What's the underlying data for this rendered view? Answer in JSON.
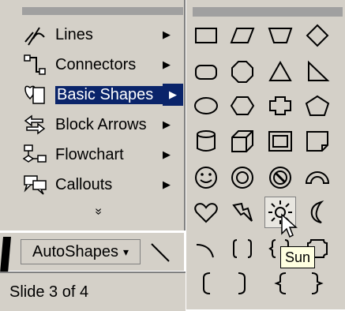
{
  "menu": {
    "items": [
      {
        "label": "Lines",
        "icon": "lines-icon",
        "has_submenu": true
      },
      {
        "label": "Connectors",
        "icon": "connectors-icon",
        "has_submenu": true
      },
      {
        "label": "Basic Shapes",
        "icon": "basic-shapes-icon",
        "has_submenu": true,
        "selected": true
      },
      {
        "label": "Block Arrows",
        "icon": "block-arrows-icon",
        "has_submenu": true
      },
      {
        "label": "Flowchart",
        "icon": "flowchart-icon",
        "has_submenu": true
      },
      {
        "label": "Callouts",
        "icon": "callouts-icon",
        "has_submenu": true
      }
    ],
    "expand_glyph": "»",
    "submenu_arrow": "▶"
  },
  "palette": {
    "shapes": [
      "rectangle",
      "parallelogram",
      "trapezoid",
      "diamond",
      "rounded-rectangle",
      "octagon",
      "isosceles-triangle",
      "right-triangle",
      "oval",
      "hexagon",
      "cross",
      "pentagon",
      "can",
      "cube",
      "bevel",
      "folded-corner",
      "smiley-face",
      "donut",
      "no-symbol",
      "block-arc",
      "heart",
      "lightning-bolt",
      "sun",
      "moon",
      "arc",
      "double-bracket",
      "double-brace",
      "plaque",
      "left-bracket",
      "right-bracket",
      "left-brace",
      "right-brace"
    ],
    "hovered": "sun"
  },
  "tooltip": "Sun",
  "toolbar": {
    "autoshapes_label": "AutoShapes",
    "dropdown_glyph": "▾"
  },
  "status": {
    "slide_text": "Slide 3 of 4"
  },
  "colors": {
    "face": "#d4d0c8",
    "highlight": "#0a246a",
    "tooltip_bg": "#ffffe1"
  }
}
